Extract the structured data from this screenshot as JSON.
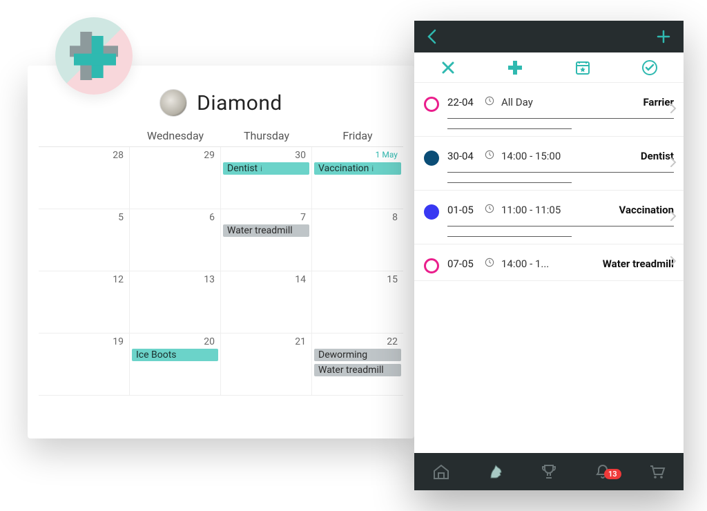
{
  "colors": {
    "teal": "#2fb9b0",
    "tealLight": "#6bd3c9",
    "greyEvent": "#bfc5c8",
    "magenta": "#ea1e8c",
    "navy": "#0b4d76",
    "blue": "#3838f2",
    "darkbar": "#262d2f",
    "badge": "#ef3a3a"
  },
  "calendar": {
    "horse_name": "Diamond",
    "columns": [
      "",
      "Wednesday",
      "Thursday",
      "Friday"
    ],
    "cells": [
      {
        "day": "28"
      },
      {
        "day": "29"
      },
      {
        "day": "30",
        "events": [
          {
            "label": "Dentist",
            "kind": "teal",
            "info": true
          }
        ]
      },
      {
        "day": "1 May",
        "alt": true,
        "events": [
          {
            "label": "Vaccination",
            "kind": "teal",
            "info": true
          }
        ]
      },
      {
        "day": "5"
      },
      {
        "day": "6"
      },
      {
        "day": "7",
        "events": [
          {
            "label": "Water treadmill",
            "kind": "grey"
          }
        ]
      },
      {
        "day": "8"
      },
      {
        "day": "12"
      },
      {
        "day": "13"
      },
      {
        "day": "14"
      },
      {
        "day": "15"
      },
      {
        "day": "19"
      },
      {
        "day": "20",
        "events": [
          {
            "label": "Ice Boots",
            "kind": "teal"
          }
        ]
      },
      {
        "day": "21"
      },
      {
        "day": "22",
        "events": [
          {
            "label": "Deworming",
            "kind": "grey"
          },
          {
            "label": "Water treadmill",
            "kind": "grey"
          }
        ]
      }
    ]
  },
  "phone": {
    "items": [
      {
        "bullet": "outline",
        "date": "22-04",
        "time": "All Day",
        "title": "Farrier"
      },
      {
        "bullet": "navy",
        "date": "30-04",
        "time": "14:00 - 15:00",
        "title": "Dentist"
      },
      {
        "bullet": "blue",
        "date": "01-05",
        "time": "11:00 - 11:05",
        "title": "Vaccination"
      },
      {
        "bullet": "outline",
        "date": "07-05",
        "time": "14:00 - 1...",
        "title": "Water treadmill"
      }
    ],
    "notification_count": "13"
  }
}
